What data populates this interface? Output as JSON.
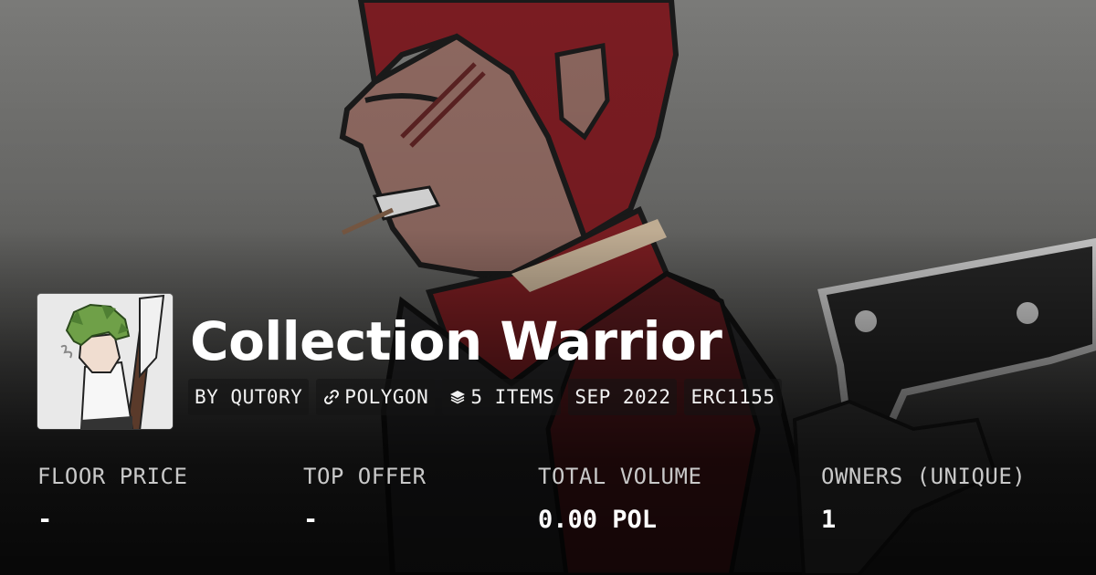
{
  "collection": {
    "title": "Collection Warrior",
    "chips": {
      "creator": "BY QUT0RY",
      "chain": "POLYGON",
      "items": "5 ITEMS",
      "date": "SEP 2022",
      "standard": "ERC1155"
    }
  },
  "stats": [
    {
      "label": "FLOOR PRICE",
      "value": "-"
    },
    {
      "label": "TOP OFFER",
      "value": "-"
    },
    {
      "label": "TOTAL VOLUME",
      "value": "0.00 POL"
    },
    {
      "label": "OWNERS (UNIQUE)",
      "value": "1"
    }
  ],
  "icons": {
    "chain": "link-icon",
    "items": "layers-icon"
  },
  "colors": {
    "text": "#ffffff",
    "label": "#c9c9c9",
    "chip_bg": "rgba(20,20,20,0.55)"
  }
}
